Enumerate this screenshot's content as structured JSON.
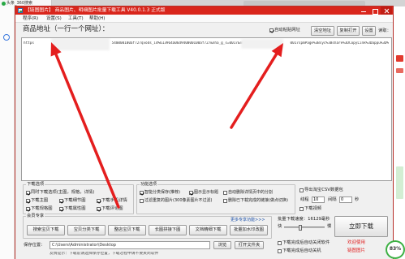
{
  "browser": {
    "tab_title": "头条_360搜索",
    "icons": {
      "tab_favicon": "360-browser-icon",
      "sidebar": "browser-sidebar-icon"
    }
  },
  "window": {
    "title": "【链图图片】 商品图片、明细图片批量下载工具 V40.0.1.3 正式版",
    "icons": {
      "app": "app-icon",
      "minimize": "minimize-icon",
      "maximize": "maximize-icon",
      "close": "close-icon"
    }
  },
  "menu": [
    {
      "label": "程序(R)"
    },
    {
      "label": "设置(S)"
    },
    {
      "label": "工具(T)"
    },
    {
      "label": "帮助(H)"
    }
  ],
  "address": {
    "label": "商品地址（一行一个网址）：",
    "auto_paste": {
      "label": "自动粘贴网址",
      "checked": true
    },
    "clear_button": "清空地址",
    "copy_open_button": "复制打开",
    "settings_button": "设置",
    "read_label": "读取："
  },
  "url_input": {
    "text": "https                                     540000100af727qvods_id%613964a06d940000100af727&nha_g_s=0017&nhs_ch                  0017spmPage%3Bsyc%3Bshare%3DCopyLink%3Dappu%3D%"
  },
  "download_options": {
    "title": "下载选项",
    "items": [
      {
        "label": "同时下载选项(主图，规格，详情)",
        "checked": true
      },
      {
        "label": "下载主图",
        "checked": true
      },
      {
        "label": "下载细节图",
        "checked": true
      },
      {
        "label": "下载手机详情",
        "checked": true
      },
      {
        "label": "下载规格图",
        "checked": true
      },
      {
        "label": "下载属性图",
        "checked": true
      },
      {
        "label": "下载评论图",
        "checked": true
      }
    ]
  },
  "feature_options": {
    "title": "功能选项",
    "items": [
      {
        "label": "智能分类保存(推荐)",
        "checked": true
      },
      {
        "label": "图示显示标题",
        "checked": true
      },
      {
        "label": "自动删除详情页中的分割",
        "checked": false
      },
      {
        "label": "过滤重复的图片(300像素图片不过滤)",
        "checked": false
      },
      {
        "label": "删除已下载完成的链接(做点切换)",
        "checked": false
      }
    ]
  },
  "extra_options": {
    "csv": {
      "label": "导出淘宝CSV数据包",
      "checked": false
    },
    "thread": {
      "label": "线程",
      "value": "10",
      "wait_label": "间隔",
      "wait_value": "0",
      "unit": "秒"
    },
    "video": {
      "label": "下载视频",
      "checked": false
    }
  },
  "member": {
    "title": "会员专享",
    "more_link": "更多专享功能>>>",
    "buttons": [
      {
        "label": "搜索宝贝下载"
      },
      {
        "label": "宝贝分类下载"
      },
      {
        "label": "整店宝贝下载"
      },
      {
        "label": "长图拼接下图"
      },
      {
        "label": "文档精细下载"
      },
      {
        "label": "批量加水印改图"
      }
    ]
  },
  "speed": {
    "label": "批量下载速度：16129毫秒",
    "fast": "快",
    "slow": "慢",
    "slider_level": 0.4
  },
  "download_now_button": "立即下载",
  "after_download": [
    {
      "label": "下载完成后自动关闭软件",
      "checked": false
    },
    {
      "label": "下载完成后自动关机",
      "checked": false
    }
  ],
  "welcome": [
    "欢迎使用",
    "链图图片"
  ],
  "save": {
    "label": "保存位置：",
    "path": "C:\\Users\\Administrator\\Desktop",
    "browse_button": "浏览",
    "open_folder_button": "打开文件夹"
  },
  "hint": "友情提示：下载前请选择保存位置，下载过程中请不要关闭软件",
  "badge": "83%",
  "colors": {
    "title_bar": "#d9261c",
    "annotation_arrow": "#e41e1e",
    "badge_ring": "#3cb043",
    "welcome_text": "#e02020"
  }
}
